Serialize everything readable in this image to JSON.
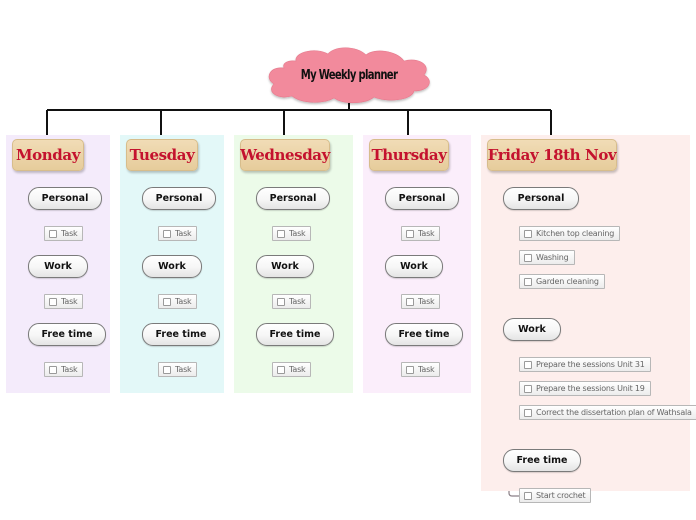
{
  "diagram": {
    "type": "mind-map",
    "root": {
      "label": "My Weekly planner",
      "shape": "cloud",
      "color": "#f28a9c"
    },
    "colors": {
      "day_header_text": "#c4122e",
      "day_header_fill": "#ecd4a6",
      "connector": "#111111",
      "branch_line": "#8a7f86"
    },
    "days": [
      {
        "label": "Monday",
        "panel_color": "#f4ebfb",
        "categories": [
          {
            "label": "Personal",
            "tasks": [
              "Task"
            ]
          },
          {
            "label": "Work",
            "tasks": [
              "Task"
            ]
          },
          {
            "label": "Free time",
            "tasks": [
              "Task"
            ]
          }
        ]
      },
      {
        "label": "Tuesday",
        "panel_color": "#e3f8f8",
        "categories": [
          {
            "label": "Personal",
            "tasks": [
              "Task"
            ]
          },
          {
            "label": "Work",
            "tasks": [
              "Task"
            ]
          },
          {
            "label": "Free time",
            "tasks": [
              "Task"
            ]
          }
        ]
      },
      {
        "label": "Wednesday",
        "panel_color": "#ecfbe9",
        "categories": [
          {
            "label": "Personal",
            "tasks": [
              "Task"
            ]
          },
          {
            "label": "Work",
            "tasks": [
              "Task"
            ]
          },
          {
            "label": "Free time",
            "tasks": [
              "Task"
            ]
          }
        ]
      },
      {
        "label": "Thursday",
        "panel_color": "#fbeefb",
        "categories": [
          {
            "label": "Personal",
            "tasks": [
              "Task"
            ]
          },
          {
            "label": "Work",
            "tasks": [
              "Task"
            ]
          },
          {
            "label": "Free time",
            "tasks": [
              "Task"
            ]
          }
        ]
      },
      {
        "label": "Friday 18th Nov",
        "panel_color": "#fdeeec",
        "categories": [
          {
            "label": "Personal",
            "tasks": [
              "Kitchen top cleaning",
              "Washing",
              "Garden cleaning"
            ]
          },
          {
            "label": "Work",
            "tasks": [
              "Prepare the sessions Unit 31",
              "Prepare the sessions Unit 19",
              "Correct the dissertation plan of Wathsala"
            ]
          },
          {
            "label": "Free time",
            "tasks": [
              "Start crochet"
            ]
          }
        ]
      }
    ]
  }
}
